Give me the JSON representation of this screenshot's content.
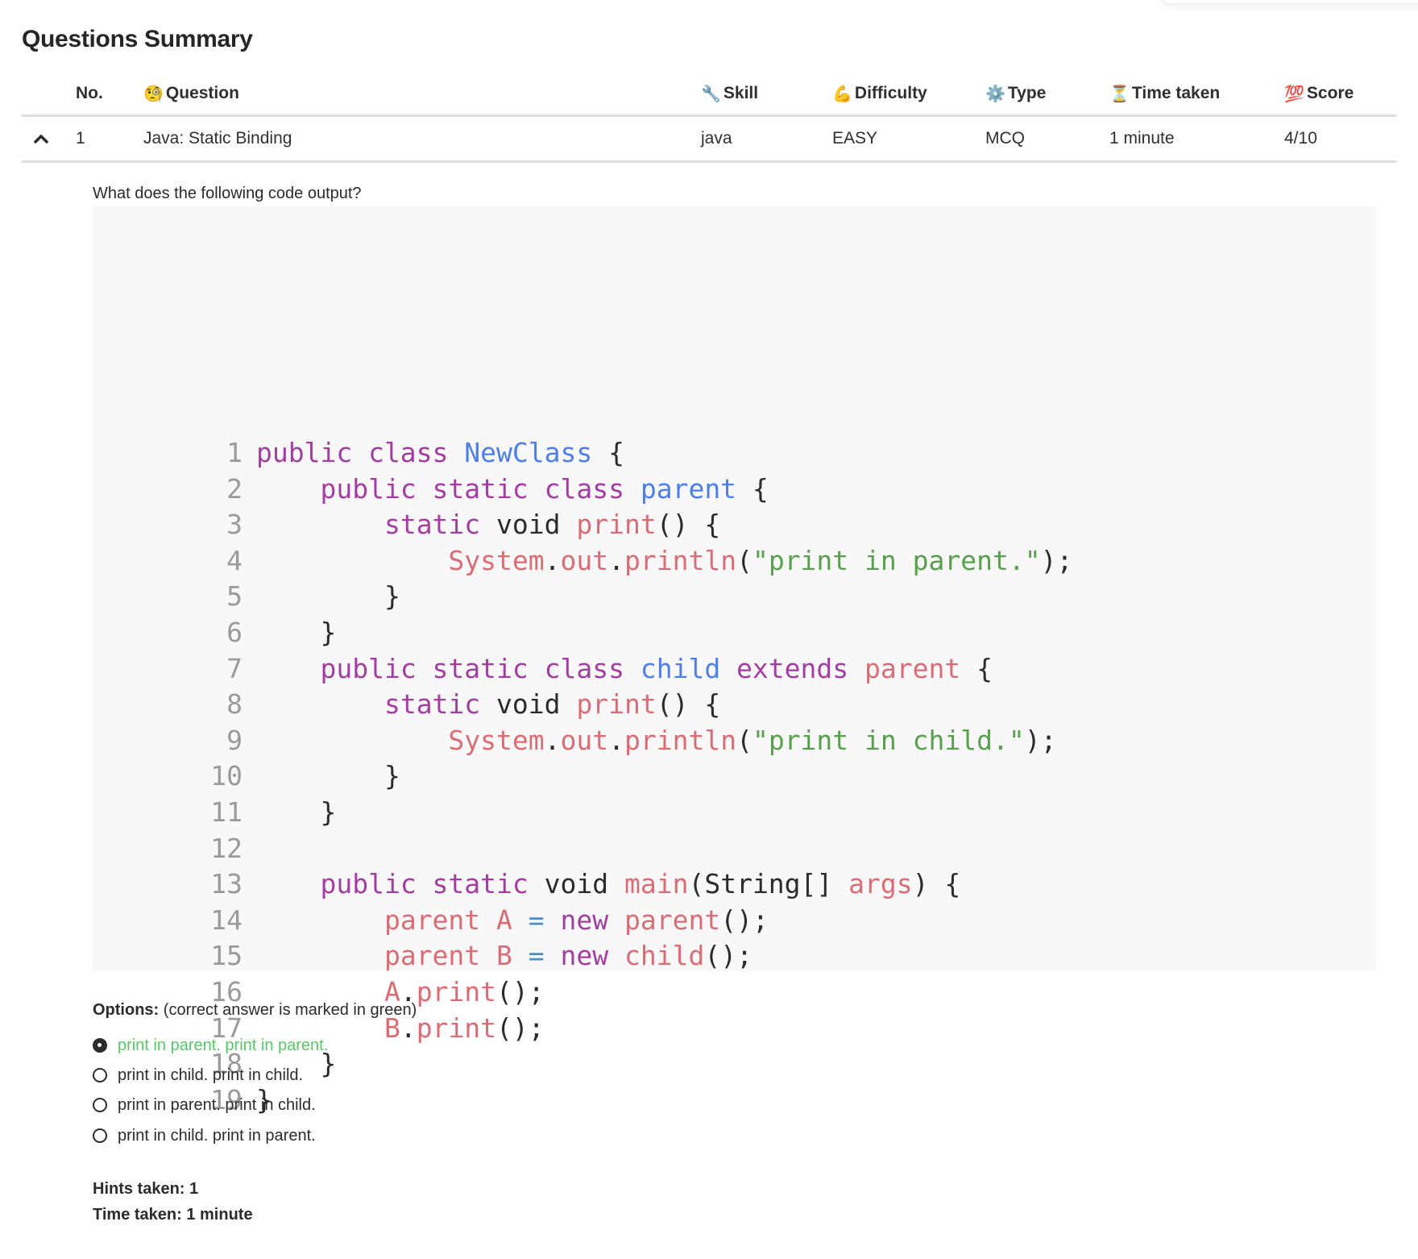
{
  "page": {
    "title": "Questions Summary"
  },
  "table": {
    "headers": [
      {
        "key": "no",
        "label": "No.",
        "icon": ""
      },
      {
        "key": "question",
        "label": "Question",
        "icon": "🧐"
      },
      {
        "key": "skill",
        "label": "Skill",
        "icon": "🔧"
      },
      {
        "key": "difficulty",
        "label": "Difficulty",
        "icon": "💪"
      },
      {
        "key": "type",
        "label": "Type",
        "icon": "⚙️"
      },
      {
        "key": "time",
        "label": "Time taken",
        "icon": "⏳"
      },
      {
        "key": "score",
        "label": "Score",
        "icon": "💯"
      }
    ],
    "rows": [
      {
        "expanded": true,
        "expand_icon": "chevron-up-icon",
        "no": "1",
        "question": "Java: Static Binding",
        "skill": "java",
        "difficulty": "EASY",
        "type": "MCQ",
        "time": "1 minute",
        "score": "4/10"
      }
    ]
  },
  "detail": {
    "prompt": "What does the following code output?",
    "code": {
      "language": "java",
      "lines": [
        [
          [
            "kw",
            "public class "
          ],
          [
            "cls",
            "NewClass"
          ],
          [
            "pl",
            " {"
          ]
        ],
        [
          [
            "pl",
            "    "
          ],
          [
            "kw",
            "public static class "
          ],
          [
            "cls",
            "parent"
          ],
          [
            "pl",
            " {"
          ]
        ],
        [
          [
            "pl",
            "        "
          ],
          [
            "kw",
            "static "
          ],
          [
            "pl",
            "void "
          ],
          [
            "fn",
            "print"
          ],
          [
            "pl",
            "() {"
          ]
        ],
        [
          [
            "pl",
            "            "
          ],
          [
            "fn",
            "System"
          ],
          [
            "pl",
            "."
          ],
          [
            "fn",
            "out"
          ],
          [
            "pl",
            "."
          ],
          [
            "fn",
            "println"
          ],
          [
            "pl",
            "("
          ],
          [
            "str",
            "\"print in parent.\""
          ],
          [
            "pl",
            ");"
          ]
        ],
        [
          [
            "pl",
            "        }"
          ]
        ],
        [
          [
            "pl",
            "    }"
          ]
        ],
        [
          [
            "pl",
            "    "
          ],
          [
            "kw",
            "public static class "
          ],
          [
            "cls",
            "child"
          ],
          [
            "kw",
            " extends "
          ],
          [
            "fn",
            "parent"
          ],
          [
            "pl",
            " {"
          ]
        ],
        [
          [
            "pl",
            "        "
          ],
          [
            "kw",
            "static "
          ],
          [
            "pl",
            "void "
          ],
          [
            "fn",
            "print"
          ],
          [
            "pl",
            "() {"
          ]
        ],
        [
          [
            "pl",
            "            "
          ],
          [
            "fn",
            "System"
          ],
          [
            "pl",
            "."
          ],
          [
            "fn",
            "out"
          ],
          [
            "pl",
            "."
          ],
          [
            "fn",
            "println"
          ],
          [
            "pl",
            "("
          ],
          [
            "str",
            "\"print in child.\""
          ],
          [
            "pl",
            ");"
          ]
        ],
        [
          [
            "pl",
            "        }"
          ]
        ],
        [
          [
            "pl",
            "    }"
          ]
        ],
        [
          [
            "pl",
            ""
          ]
        ],
        [
          [
            "pl",
            "    "
          ],
          [
            "kw",
            "public static "
          ],
          [
            "pl",
            "void "
          ],
          [
            "fn",
            "main"
          ],
          [
            "pl",
            "(String[] "
          ],
          [
            "fn",
            "args"
          ],
          [
            "pl",
            ") {"
          ]
        ],
        [
          [
            "pl",
            "        "
          ],
          [
            "fn",
            "parent A "
          ],
          [
            "op",
            "="
          ],
          [
            "kw",
            " new "
          ],
          [
            "fn",
            "parent"
          ],
          [
            "pl",
            "();"
          ]
        ],
        [
          [
            "pl",
            "        "
          ],
          [
            "fn",
            "parent B "
          ],
          [
            "op",
            "="
          ],
          [
            "kw",
            " new "
          ],
          [
            "fn",
            "child"
          ],
          [
            "pl",
            "();"
          ]
        ],
        [
          [
            "pl",
            "        "
          ],
          [
            "fn",
            "A"
          ],
          [
            "pl",
            "."
          ],
          [
            "fn",
            "print"
          ],
          [
            "pl",
            "();"
          ]
        ],
        [
          [
            "pl",
            "        "
          ],
          [
            "fn",
            "B"
          ],
          [
            "pl",
            "."
          ],
          [
            "fn",
            "print"
          ],
          [
            "pl",
            "();"
          ]
        ],
        [
          [
            "pl",
            "    }"
          ]
        ],
        [
          [
            "pl",
            "}"
          ]
        ]
      ]
    },
    "options_label": "Options:",
    "options_note": "(correct answer is marked in green)",
    "options": [
      {
        "text": "print in parent. print in parent.",
        "selected": true,
        "correct": true
      },
      {
        "text": "print in child. print in child.",
        "selected": false,
        "correct": false
      },
      {
        "text": "print in parent. print in child.",
        "selected": false,
        "correct": false
      },
      {
        "text": "print in child. print in parent.",
        "selected": false,
        "correct": false
      }
    ],
    "hints_taken": "Hints taken: 1",
    "time_taken": "Time taken: 1 minute"
  },
  "colors": {
    "correct": "#5cc569",
    "keyword": "#a33ea1",
    "class_name": "#4f7ee8",
    "identifier": "#d96d76",
    "string": "#5a9e4f",
    "code_bg": "#f8f8f8"
  }
}
